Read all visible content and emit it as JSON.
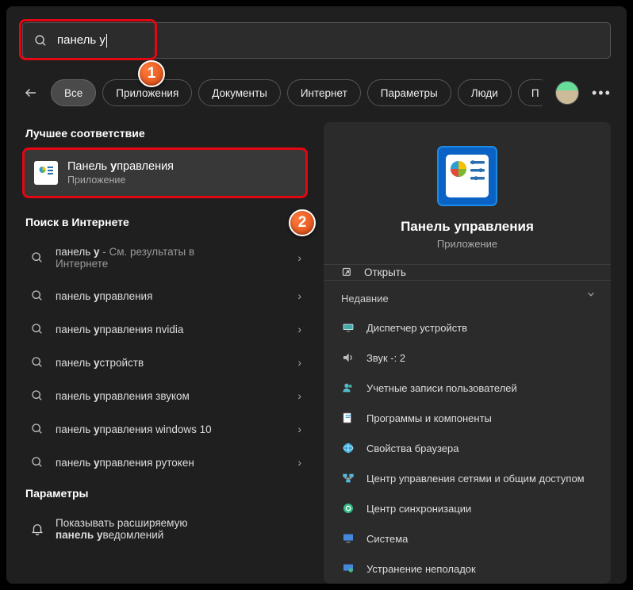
{
  "search": {
    "query": "панель у"
  },
  "tabs": [
    "Все",
    "Приложения",
    "Документы",
    "Интернет",
    "Параметры",
    "Люди",
    "П"
  ],
  "sections": {
    "best": "Лучшее соответствие",
    "web": "Поиск в Интернете",
    "settings": "Параметры"
  },
  "bestMatch": {
    "title_pre": "Панель ",
    "title_hl": "у",
    "title_post": "правления",
    "sub": "Приложение"
  },
  "webResults": [
    {
      "pre": "панель ",
      "hl": "у",
      "post": "",
      "suffix": " - См. результаты в",
      "line2": "Интернете",
      "tall": true
    },
    {
      "pre": "панель ",
      "hl": "у",
      "post": "правления"
    },
    {
      "pre": "панель ",
      "hl": "у",
      "post": "правления nvidia"
    },
    {
      "pre": "панель ",
      "hl": "у",
      "post": "стройств"
    },
    {
      "pre": "панель ",
      "hl": "у",
      "post": "правления звуком"
    },
    {
      "pre": "панель ",
      "hl": "у",
      "post": "правления windows 10"
    },
    {
      "pre": "панель ",
      "hl": "у",
      "post": "правления рутокен"
    }
  ],
  "settingsResult": {
    "line1": "Показывать расширяемую",
    "line2_pre": "панель ",
    "line2_hl": "у",
    "line2_post": "ведомлений"
  },
  "preview": {
    "title": "Панель управления",
    "sub": "Приложение",
    "open": "Открыть",
    "recentHeader": "Недавние",
    "recent": [
      "Диспетчер устройств",
      "Звук -: 2",
      "Учетные записи пользователей",
      "Программы и компоненты",
      "Свойства браузера",
      "Центр управления сетями и общим доступом",
      "Центр синхронизации",
      "Система",
      "Устранение неполадок"
    ]
  }
}
